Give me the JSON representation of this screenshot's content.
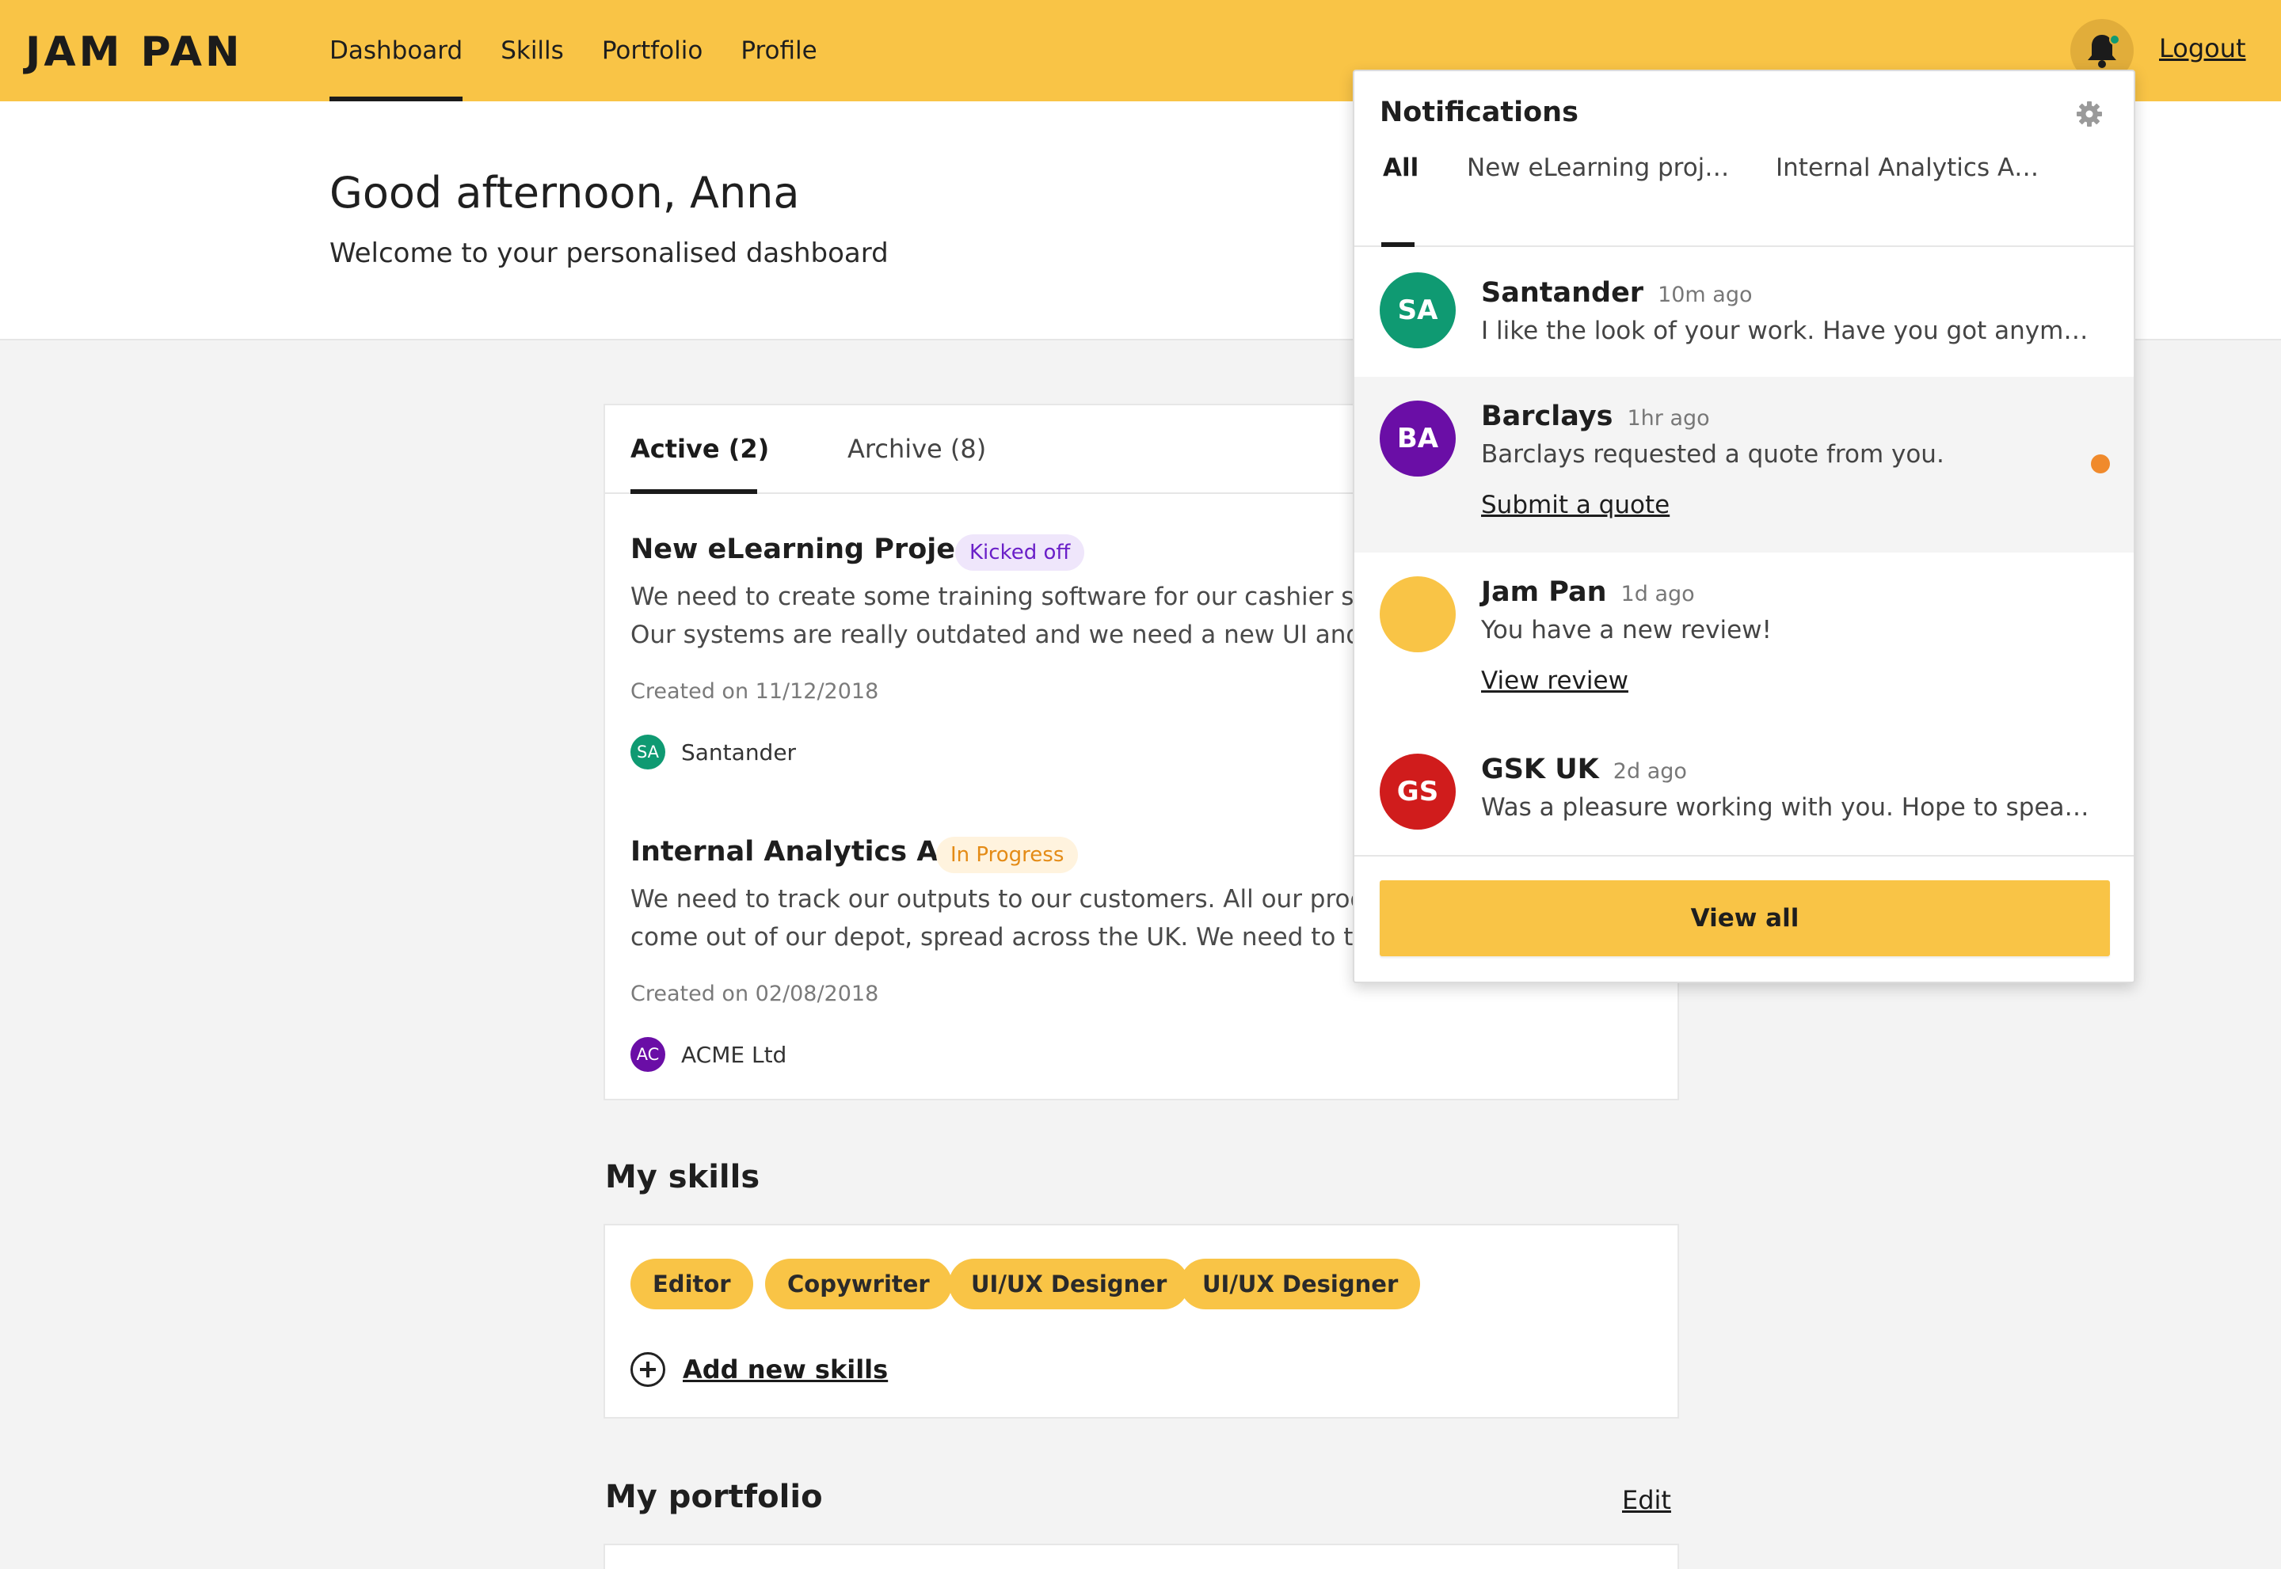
{
  "app": {
    "logo": "JAM PAN"
  },
  "nav": {
    "items": [
      {
        "label": "Dashboard",
        "active": true
      },
      {
        "label": "Skills",
        "active": false
      },
      {
        "label": "Portfolio",
        "active": false
      },
      {
        "label": "Profile",
        "active": false
      }
    ],
    "logout": "Logout"
  },
  "hero": {
    "greeting": "Good afternoon, Anna",
    "subtitle": "Welcome to your personalised dashboard"
  },
  "projects": {
    "tabs": [
      {
        "label": "Active (2)",
        "active": true
      },
      {
        "label": "Archive (8)",
        "active": false
      }
    ],
    "items": [
      {
        "title": "New eLearning Project",
        "status": "Kicked off",
        "desc_line1": "We need to create some training software for our cashier staf",
        "desc_line2": "Our systems are really outdated and we need a new UI and U",
        "created": "Created on 11/12/2018",
        "client_initials": "SA",
        "client_name": "Santander",
        "client_color": "#0f9a72"
      },
      {
        "title": "Internal Analytics App",
        "status": "In Progress",
        "desc_line1": "We need to track our outputs to our customers. All our produ",
        "desc_line2": "come out of our depot, spread across the UK. We need to tra",
        "created": "Created on 02/08/2018",
        "client_initials": "AC",
        "client_name": "ACME Ltd",
        "client_color": "#6a0ea6"
      }
    ]
  },
  "skills": {
    "title": "My skills",
    "items": [
      "Editor",
      "Copywriter",
      "UI/UX Designer",
      "UI/UX Designer"
    ],
    "add_label": "Add new skills"
  },
  "portfolio": {
    "title": "My portfolio",
    "edit_label": "Edit"
  },
  "notifications": {
    "title": "Notifications",
    "tabs": [
      {
        "label": "All",
        "active": true
      },
      {
        "label": "New eLearning proj…",
        "active": false
      },
      {
        "label": "Internal Analytics A…",
        "active": false
      }
    ],
    "items": [
      {
        "initials": "SA",
        "sender": "Santander",
        "time": "10m ago",
        "message": "I like the look of your work. Have you got anym…",
        "link": "",
        "unread": false,
        "color": "#0f9a72"
      },
      {
        "initials": "BA",
        "sender": "Barclays",
        "time": "1hr ago",
        "message": "Barclays requested a quote from you.",
        "link": "Submit a quote",
        "unread": true,
        "color": "#6a0ea6"
      },
      {
        "initials": "",
        "sender": "Jam Pan",
        "time": "1d ago",
        "message": "You have a new review!",
        "link": "View review",
        "unread": false,
        "color": "#f9c446"
      },
      {
        "initials": "GS",
        "sender": "GSK UK",
        "time": "2d ago",
        "message": "Was a pleasure working with you. Hope to spea…",
        "link": "",
        "unread": false,
        "color": "#d01c1c"
      }
    ],
    "view_all": "View all"
  },
  "colors": {
    "brand": "#f9c446",
    "unread": "#f08a2c",
    "kicked_off": "#6a1fc8",
    "in_progress": "#e48b16"
  }
}
